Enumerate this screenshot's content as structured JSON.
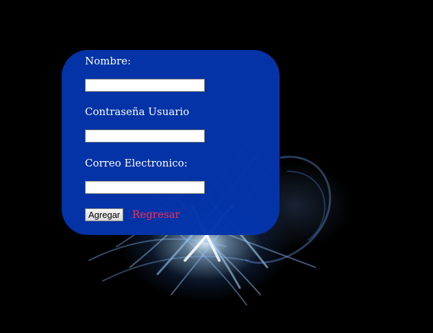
{
  "form": {
    "name_label": "Nombre:",
    "name_value": "",
    "password_label": "Contraseña Usuario",
    "password_value": "",
    "email_label": "Correo Electronico:",
    "email_value": "",
    "submit_label": "Agregar",
    "back_link": "Regresar"
  },
  "colors": {
    "background": "#000000",
    "panel": "#0334aa",
    "label_text": "#ffffff",
    "link": "#ff2d55"
  }
}
